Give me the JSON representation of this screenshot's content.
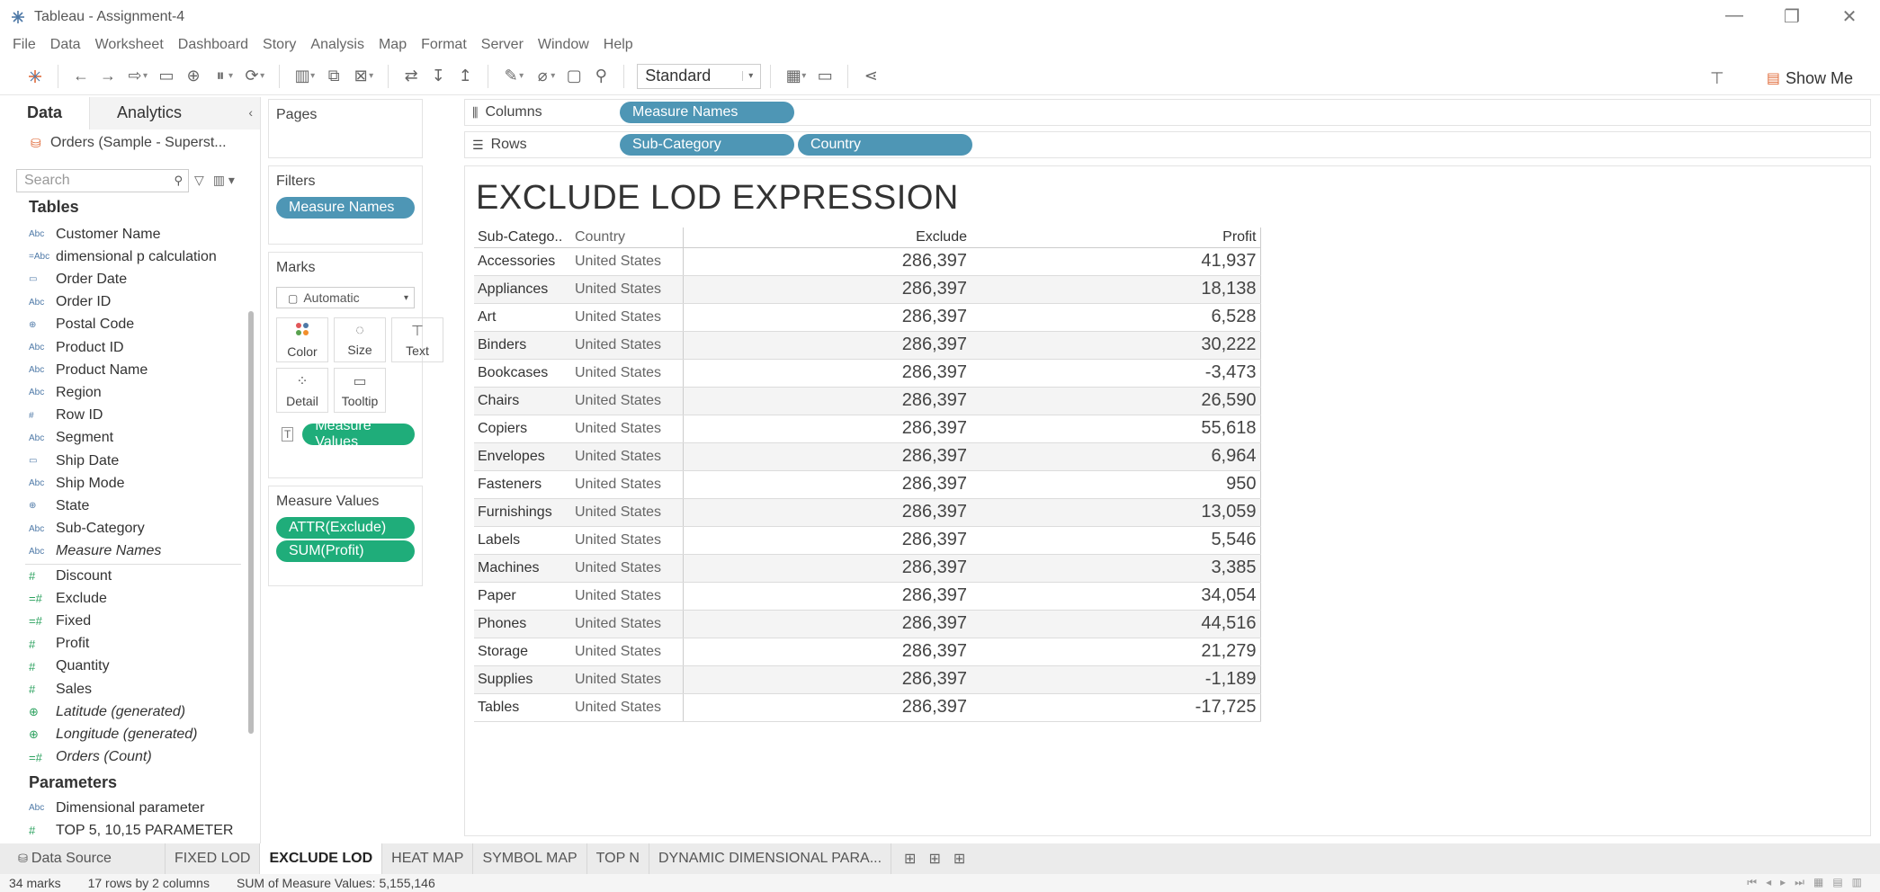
{
  "window": {
    "title": "Tableau - Assignment-4",
    "controls": {
      "minimize": "—",
      "restore": "❐",
      "close": "✕"
    }
  },
  "menu": [
    "File",
    "Data",
    "Worksheet",
    "Dashboard",
    "Story",
    "Analysis",
    "Map",
    "Format",
    "Server",
    "Window",
    "Help"
  ],
  "toolbar": {
    "fit_value": "Standard",
    "show_me_label": "Show Me"
  },
  "data_pane": {
    "tabs": {
      "data": "Data",
      "analytics": "Analytics"
    },
    "source": "Orders (Sample - Superst...",
    "search_placeholder": "Search",
    "tables_title": "Tables",
    "dimensions": [
      {
        "type": "Abc",
        "label": "Customer Name",
        "italic": false
      },
      {
        "type": "=Abc",
        "label": "dimensional p calculation",
        "italic": false
      },
      {
        "type": "date",
        "label": "Order Date",
        "italic": false
      },
      {
        "type": "Abc",
        "label": "Order ID",
        "italic": false
      },
      {
        "type": "geo",
        "label": "Postal Code",
        "italic": false
      },
      {
        "type": "Abc",
        "label": "Product ID",
        "italic": false
      },
      {
        "type": "Abc",
        "label": "Product Name",
        "italic": false
      },
      {
        "type": "Abc",
        "label": "Region",
        "italic": false
      },
      {
        "type": "#",
        "label": "Row ID",
        "italic": false
      },
      {
        "type": "Abc",
        "label": "Segment",
        "italic": false
      },
      {
        "type": "date",
        "label": "Ship Date",
        "italic": false
      },
      {
        "type": "Abc",
        "label": "Ship Mode",
        "italic": false
      },
      {
        "type": "geo",
        "label": "State",
        "italic": false
      },
      {
        "type": "Abc",
        "label": "Sub-Category",
        "italic": false
      },
      {
        "type": "Abc",
        "label": "Measure Names",
        "italic": true
      }
    ],
    "measures": [
      {
        "type": "#",
        "label": "Discount",
        "italic": false
      },
      {
        "type": "=#",
        "label": "Exclude",
        "italic": false
      },
      {
        "type": "=#",
        "label": "Fixed",
        "italic": false
      },
      {
        "type": "#",
        "label": "Profit",
        "italic": false
      },
      {
        "type": "#",
        "label": "Quantity",
        "italic": false
      },
      {
        "type": "#",
        "label": "Sales",
        "italic": false
      },
      {
        "type": "geo",
        "label": "Latitude (generated)",
        "italic": true
      },
      {
        "type": "geo",
        "label": "Longitude (generated)",
        "italic": true
      },
      {
        "type": "=#",
        "label": "Orders (Count)",
        "italic": true
      }
    ],
    "parameters_title": "Parameters",
    "parameters": [
      {
        "type": "Abc",
        "label": "Dimensional parameter"
      },
      {
        "type": "#",
        "label": "TOP 5, 10,15 PARAMETER"
      }
    ]
  },
  "cards": {
    "pages_title": "Pages",
    "filters_title": "Filters",
    "filters": [
      "Measure Names"
    ],
    "marks_title": "Marks",
    "marks_type": "Automatic",
    "mark_buttons": [
      {
        "icon": "color",
        "label": "Color"
      },
      {
        "icon": "size",
        "label": "Size"
      },
      {
        "icon": "text",
        "label": "Text"
      },
      {
        "icon": "detail",
        "label": "Detail"
      },
      {
        "icon": "tooltip",
        "label": "Tooltip"
      }
    ],
    "marks_pill": "Measure Values",
    "measure_values_title": "Measure Values",
    "measure_values": [
      "ATTR(Exclude)",
      "SUM(Profit)"
    ]
  },
  "shelves": {
    "columns_label": "Columns",
    "columns": [
      "Measure Names"
    ],
    "rows_label": "Rows",
    "rows": [
      "Sub-Category",
      "Country"
    ]
  },
  "view": {
    "title": "EXCLUDE LOD EXPRESSION",
    "headers": [
      "Sub-Catego..",
      "Country",
      "Exclude",
      "Profit"
    ],
    "rows": [
      [
        "Accessories",
        "United States",
        "286,397",
        "41,937"
      ],
      [
        "Appliances",
        "United States",
        "286,397",
        "18,138"
      ],
      [
        "Art",
        "United States",
        "286,397",
        "6,528"
      ],
      [
        "Binders",
        "United States",
        "286,397",
        "30,222"
      ],
      [
        "Bookcases",
        "United States",
        "286,397",
        "-3,473"
      ],
      [
        "Chairs",
        "United States",
        "286,397",
        "26,590"
      ],
      [
        "Copiers",
        "United States",
        "286,397",
        "55,618"
      ],
      [
        "Envelopes",
        "United States",
        "286,397",
        "6,964"
      ],
      [
        "Fasteners",
        "United States",
        "286,397",
        "950"
      ],
      [
        "Furnishings",
        "United States",
        "286,397",
        "13,059"
      ],
      [
        "Labels",
        "United States",
        "286,397",
        "5,546"
      ],
      [
        "Machines",
        "United States",
        "286,397",
        "3,385"
      ],
      [
        "Paper",
        "United States",
        "286,397",
        "34,054"
      ],
      [
        "Phones",
        "United States",
        "286,397",
        "44,516"
      ],
      [
        "Storage",
        "United States",
        "286,397",
        "21,279"
      ],
      [
        "Supplies",
        "United States",
        "286,397",
        "-1,189"
      ],
      [
        "Tables",
        "United States",
        "286,397",
        "-17,725"
      ]
    ]
  },
  "sheet_tabs": {
    "data_source": "Data Source",
    "tabs": [
      "FIXED LOD",
      "EXCLUDE LOD",
      "HEAT MAP",
      "SYMBOL MAP",
      "TOP N",
      "DYNAMIC DIMENSIONAL PARA..."
    ],
    "active": "EXCLUDE LOD"
  },
  "status": {
    "marks": "34 marks",
    "rows_cols": "17 rows by 2 columns",
    "sum": "SUM of Measure Values: 5,155,146"
  },
  "colors": {
    "pill_blue": "#4e96b5",
    "pill_green": "#1fad7a"
  }
}
